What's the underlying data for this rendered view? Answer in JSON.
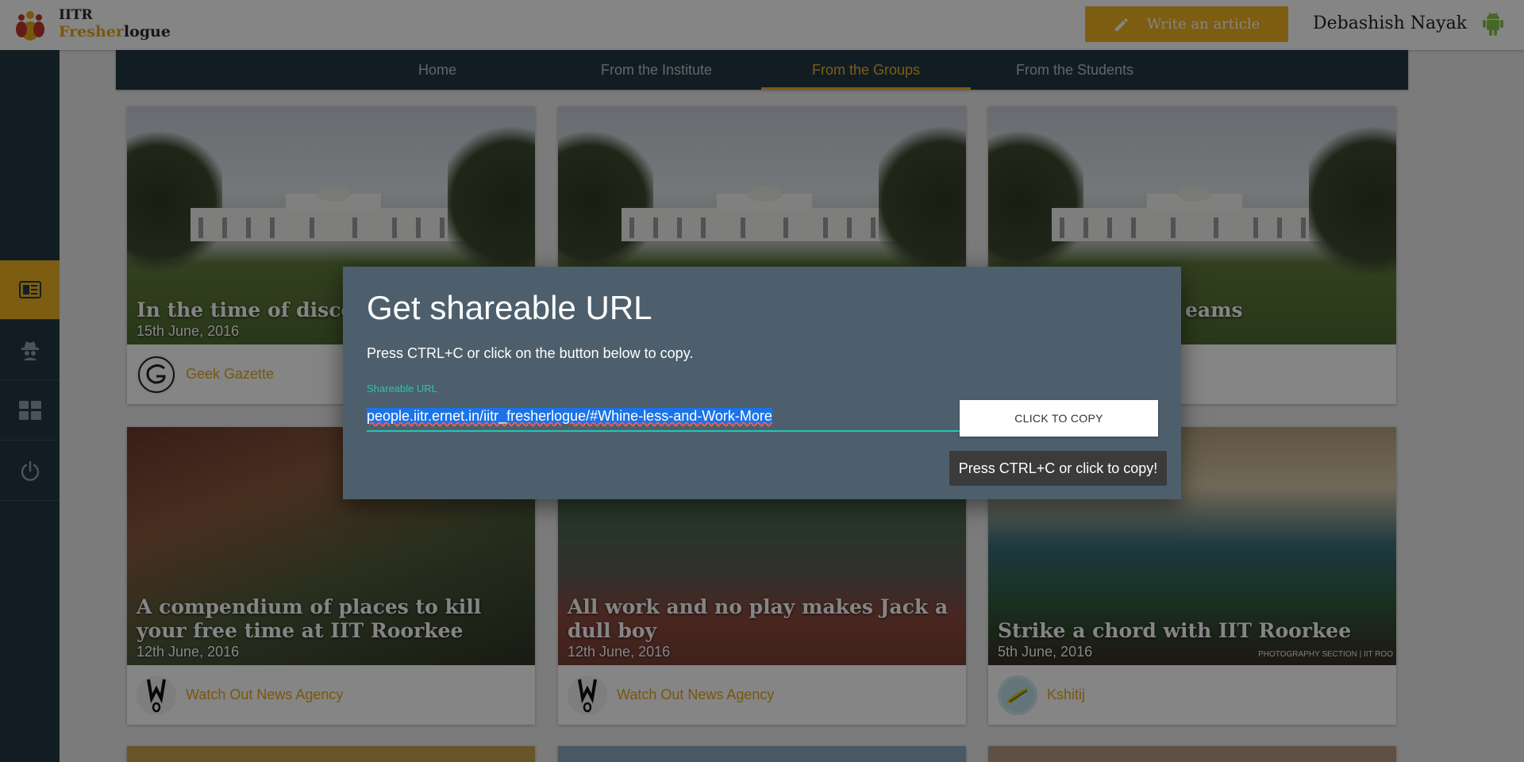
{
  "header": {
    "brand_line1": "IITR",
    "brand_fresher": "Fresher",
    "brand_logue": "logue",
    "write_button_label": "Write an article",
    "user_name": "Debashish Nayak"
  },
  "sidebar": {
    "items": [
      {
        "icon": "article-icon",
        "active": true
      },
      {
        "icon": "spy-icon",
        "active": false
      },
      {
        "icon": "dashboard-icon",
        "active": false
      },
      {
        "icon": "power-icon",
        "active": false
      }
    ]
  },
  "nav": {
    "tabs": [
      {
        "label": "Home",
        "active": false
      },
      {
        "label": "From the Institute",
        "active": false
      },
      {
        "label": "From the Groups",
        "active": true
      },
      {
        "label": "From the Students",
        "active": false
      }
    ]
  },
  "cards": [
    {
      "title": "In the time of discover",
      "date": "15th June, 2016",
      "group": "Geek Gazette"
    },
    {
      "title": "",
      "date": "",
      "group": ""
    },
    {
      "title": "eams",
      "date": "",
      "group": ""
    },
    {
      "title": "A compendium of places to kill your free time at IIT Roorkee",
      "date": "12th June, 2016",
      "group": "Watch Out News Agency"
    },
    {
      "title": "All work and no play makes Jack a dull boy",
      "date": "12th June, 2016",
      "group": "Watch Out News Agency"
    },
    {
      "title": "Strike a chord with IIT Roorkee",
      "date": "5th June, 2016",
      "group": "Kshitij",
      "watermark": "PHOTOGRAPHY SECTION | IIT ROO"
    }
  ],
  "dialog": {
    "title": "Get shareable URL",
    "instruction": "Press CTRL+C or click on the button below to copy.",
    "field_label": "Shareable URL",
    "url_value": "people.iitr.ernet.in/iitr_fresherlogue/#Whine-less-and-Work-More",
    "copy_button_label": "CLICK TO COPY",
    "tooltip": "Press CTRL+C or click to copy!"
  },
  "colors": {
    "accent": "#eeb224",
    "sidebar_bg": "#243843",
    "dialog_bg": "#4d5f6c",
    "field_accent": "#26c6b0"
  }
}
